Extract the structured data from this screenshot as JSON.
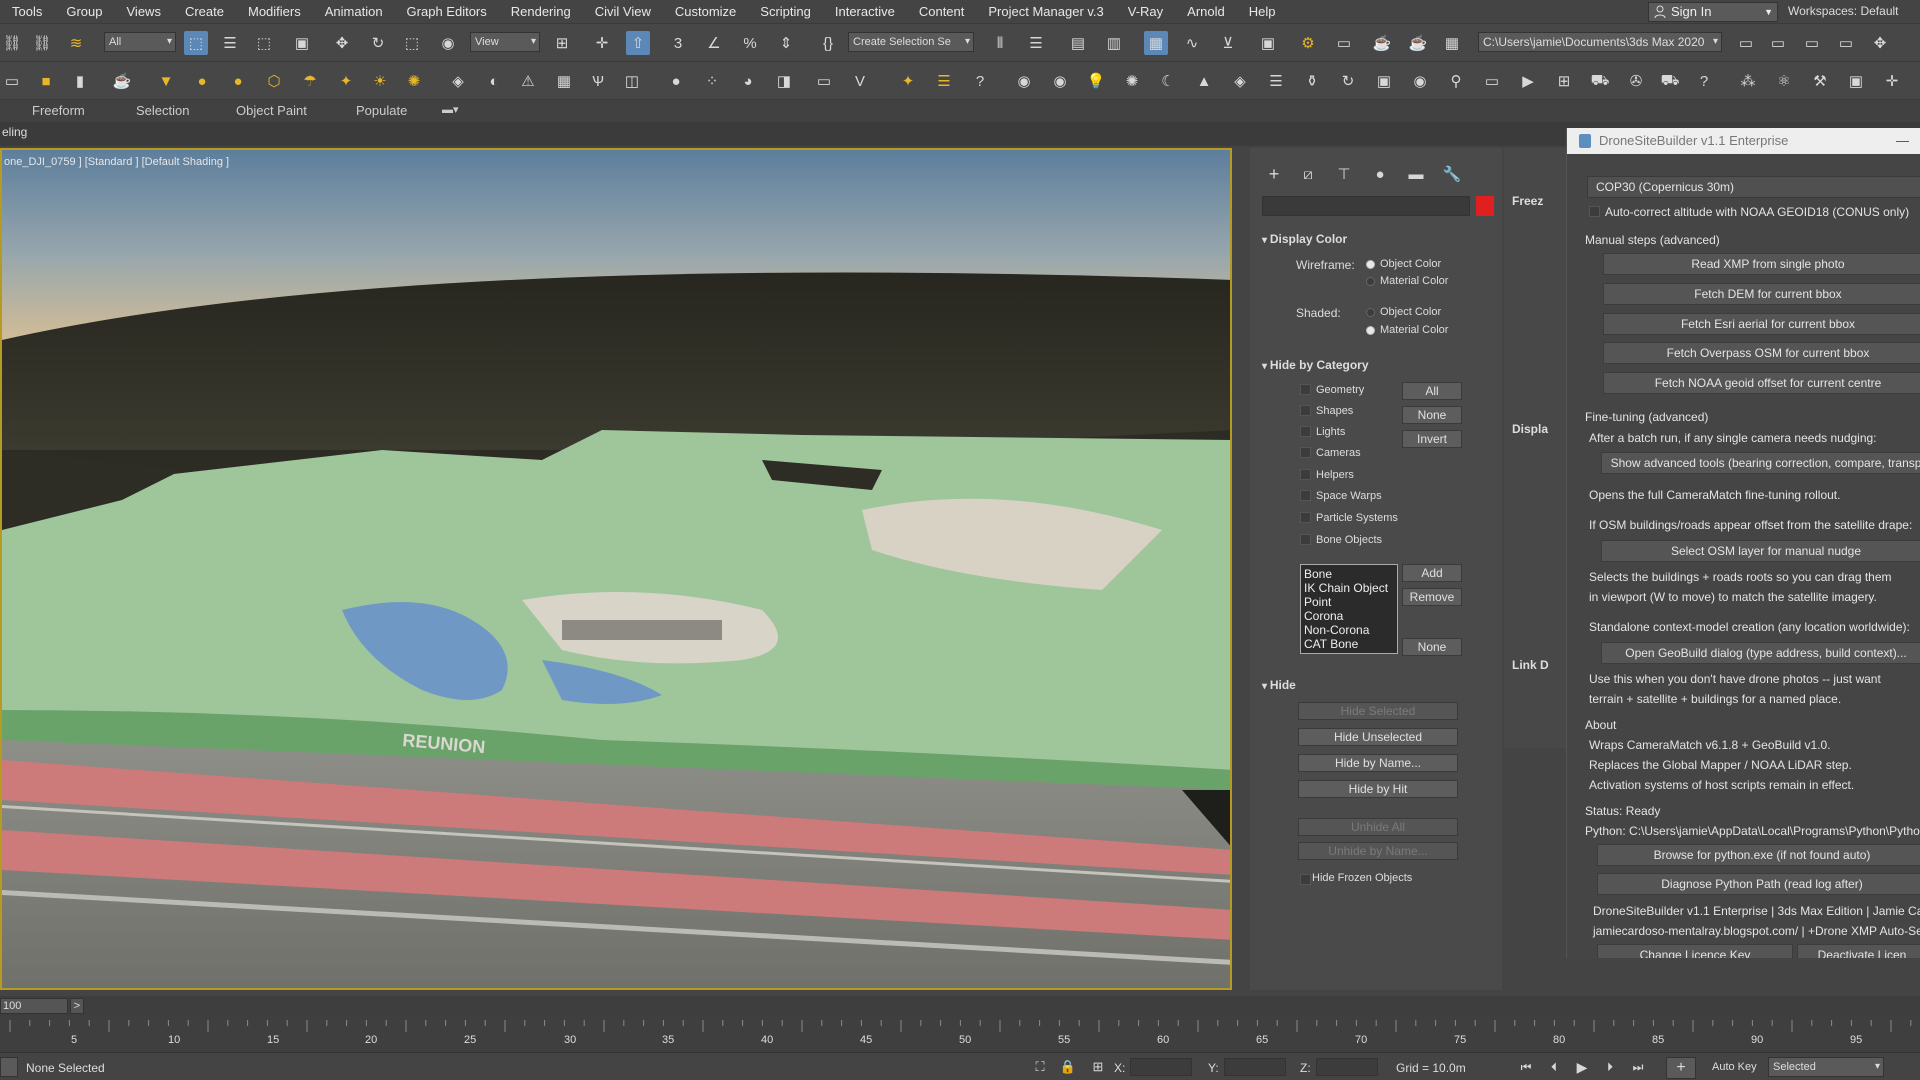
{
  "menu": [
    "Tools",
    "Group",
    "Views",
    "Create",
    "Modifiers",
    "Animation",
    "Graph Editors",
    "Rendering",
    "Civil View",
    "Customize",
    "Scripting",
    "Interactive",
    "Content",
    "Project Manager v.3",
    "V-Ray",
    "Arnold",
    "Help"
  ],
  "signin": "Sign In",
  "workspaces": "Workspaces: Default",
  "toolbar": {
    "filter": "All",
    "view": "View",
    "selection_set": "Create Selection Se",
    "project_path": "C:\\Users\\jamie\\Documents\\3ds Max 2020"
  },
  "ribbon": {
    "tabs": [
      "Freeform",
      "Selection",
      "Object Paint",
      "Populate"
    ]
  },
  "scene_explorer": "eling",
  "viewport": {
    "label": "one_DJI_0759 ] [Standard ] [Default Shading ]",
    "sign_text": "REUNION"
  },
  "command_panel": {
    "display_color": {
      "title": "Display Color",
      "wireframe_label": "Wireframe:",
      "shaded_label": "Shaded:",
      "object_color": "Object Color",
      "material_color": "Material Color"
    },
    "hide_by_category": {
      "title": "Hide by Category",
      "items": [
        "Geometry",
        "Shapes",
        "Lights",
        "Cameras",
        "Helpers",
        "Space Warps",
        "Particle Systems",
        "Bone Objects"
      ],
      "btn_all": "All",
      "btn_none": "None",
      "btn_invert": "Invert",
      "list": [
        "Bone",
        "IK Chain Object",
        "Point",
        "Corona",
        "Non-Corona",
        "CAT Bone"
      ],
      "btn_add": "Add",
      "btn_remove": "Remove",
      "btn_none2": "None"
    },
    "hide": {
      "title": "Hide",
      "hide_selected": "Hide Selected",
      "hide_unselected": "Hide Unselected",
      "hide_by_name": "Hide by Name...",
      "hide_by_hit": "Hide by Hit",
      "unhide_all": "Unhide All",
      "unhide_by_name": "Unhide by Name...",
      "hide_frozen": "Hide Frozen Objects"
    },
    "col2": {
      "freeze": "Freez",
      "displa": "Displa",
      "link": "Link D"
    }
  },
  "plugin": {
    "title": "DroneSiteBuilder v1.1 Enterprise",
    "dem": "COP30 (Copernicus 30m)",
    "autocorrect": "Auto-correct altitude with NOAA GEOID18 (CONUS only)",
    "manual_header": "Manual steps (advanced)",
    "manual_buttons": [
      "Read XMP from single photo",
      "Fetch DEM for current bbox",
      "Fetch Esri aerial for current bbox",
      "Fetch Overpass OSM for current bbox",
      "Fetch NOAA geoid offset for current centre"
    ],
    "fine_header": "Fine-tuning (advanced)",
    "fine_text1": "After a batch run, if any single camera needs nudging:",
    "fine_btn1": "Show advanced tools (bearing correction, compare, transp",
    "fine_text2": "Opens the full CameraMatch fine-tuning rollout.",
    "fine_text3": "If OSM buildings/roads appear offset from the satellite drape:",
    "fine_btn2": "Select OSM layer for manual nudge",
    "fine_text4": "Selects the buildings + roads roots so you can drag them",
    "fine_text5": "in viewport (W to move) to match the satellite imagery.",
    "fine_text6": "Standalone context-model creation (any location worldwide):",
    "fine_btn3": "Open GeoBuild dialog (type address, build context)...",
    "fine_text7": "Use this when you don't have drone photos -- just want",
    "fine_text8": "terrain + satellite + buildings for a named place.",
    "about_header": "About",
    "about1": "Wraps CameraMatch v6.1.8 + GeoBuild v1.0.",
    "about2": "Replaces the Global Mapper / NOAA LiDAR step.",
    "about3": "Activation systems of host scripts remain in effect.",
    "status": "Status: Ready",
    "python": "Python: C:\\Users\\jamie\\AppData\\Local\\Programs\\Python\\Pytho",
    "browse": "Browse for python.exe (if not found auto)",
    "diagnose": "Diagnose Python Path (read log after)",
    "footer1": "DroneSiteBuilder v1.1 Enterprise | 3ds Max Edition | Jamie Car",
    "footer2": "jamiecardoso-mentalray.blogspot.com/ | +Drone XMP Auto-Se",
    "change_key": "Change Licence Key",
    "deactivate": "Deactivate Licen"
  },
  "timeslider": {
    "frame": "100",
    "arrow": ">"
  },
  "ruler_ticks": [
    "5",
    "10",
    "15",
    "20",
    "25",
    "30",
    "35",
    "40",
    "45",
    "50",
    "55",
    "60",
    "65",
    "70",
    "75",
    "80",
    "85",
    "90",
    "95"
  ],
  "status": {
    "none_selected": "None Selected",
    "x": "X:",
    "y": "Y:",
    "z": "Z:",
    "grid": "Grid = 10.0m",
    "autokey": "Auto Key",
    "selected": "Selected"
  }
}
